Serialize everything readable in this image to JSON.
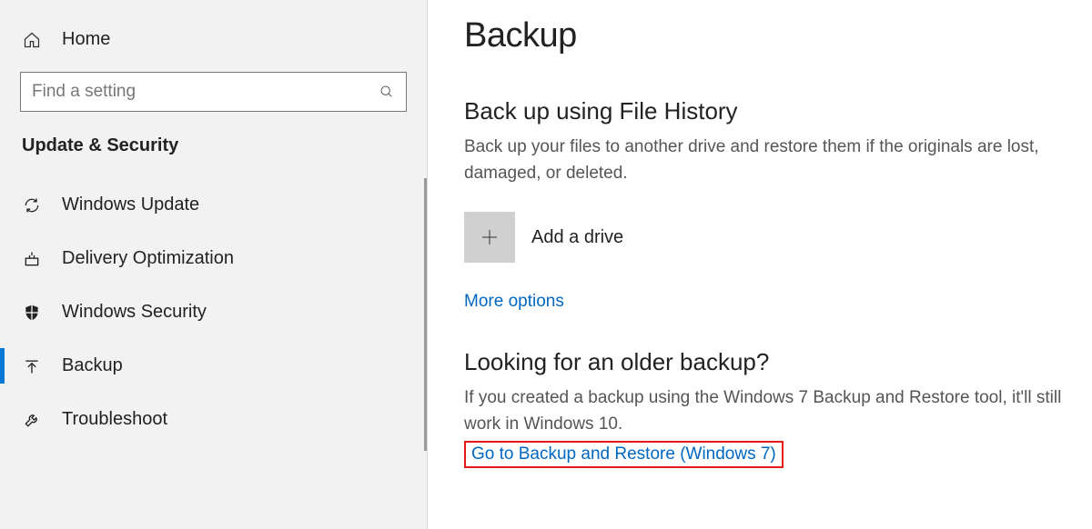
{
  "sidebar": {
    "home_label": "Home",
    "search_placeholder": "Find a setting",
    "section_header": "Update & Security",
    "items": [
      {
        "label": "Windows Update",
        "icon": "refresh-icon"
      },
      {
        "label": "Delivery Optimization",
        "icon": "delivery-icon"
      },
      {
        "label": "Windows Security",
        "icon": "shield-icon"
      },
      {
        "label": "Backup",
        "icon": "backup-icon"
      },
      {
        "label": "Troubleshoot",
        "icon": "wrench-icon"
      }
    ]
  },
  "main": {
    "page_title": "Backup",
    "file_history": {
      "title": "Back up using File History",
      "desc": "Back up your files to another drive and restore them if the originals are lost, damaged, or deleted.",
      "add_drive_label": "Add a drive",
      "more_options_label": "More options"
    },
    "older_backup": {
      "title": "Looking for an older backup?",
      "desc": "If you created a backup using the Windows 7 Backup and Restore tool, it'll still work in Windows 10.",
      "link_label": "Go to Backup and Restore (Windows 7)"
    }
  }
}
